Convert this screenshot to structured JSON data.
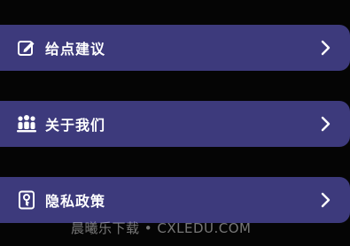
{
  "menu": {
    "items": [
      {
        "label": "给点建议",
        "icon": "edit-icon"
      },
      {
        "label": "关于我们",
        "icon": "team-icon"
      },
      {
        "label": "隐私政策",
        "icon": "privacy-key-icon"
      }
    ]
  },
  "watermark": "晨曦乐下载 • CXLEDU.COM",
  "colors": {
    "background": "#050505",
    "row_background": "#3d3a7c",
    "text": "#ffffff"
  }
}
